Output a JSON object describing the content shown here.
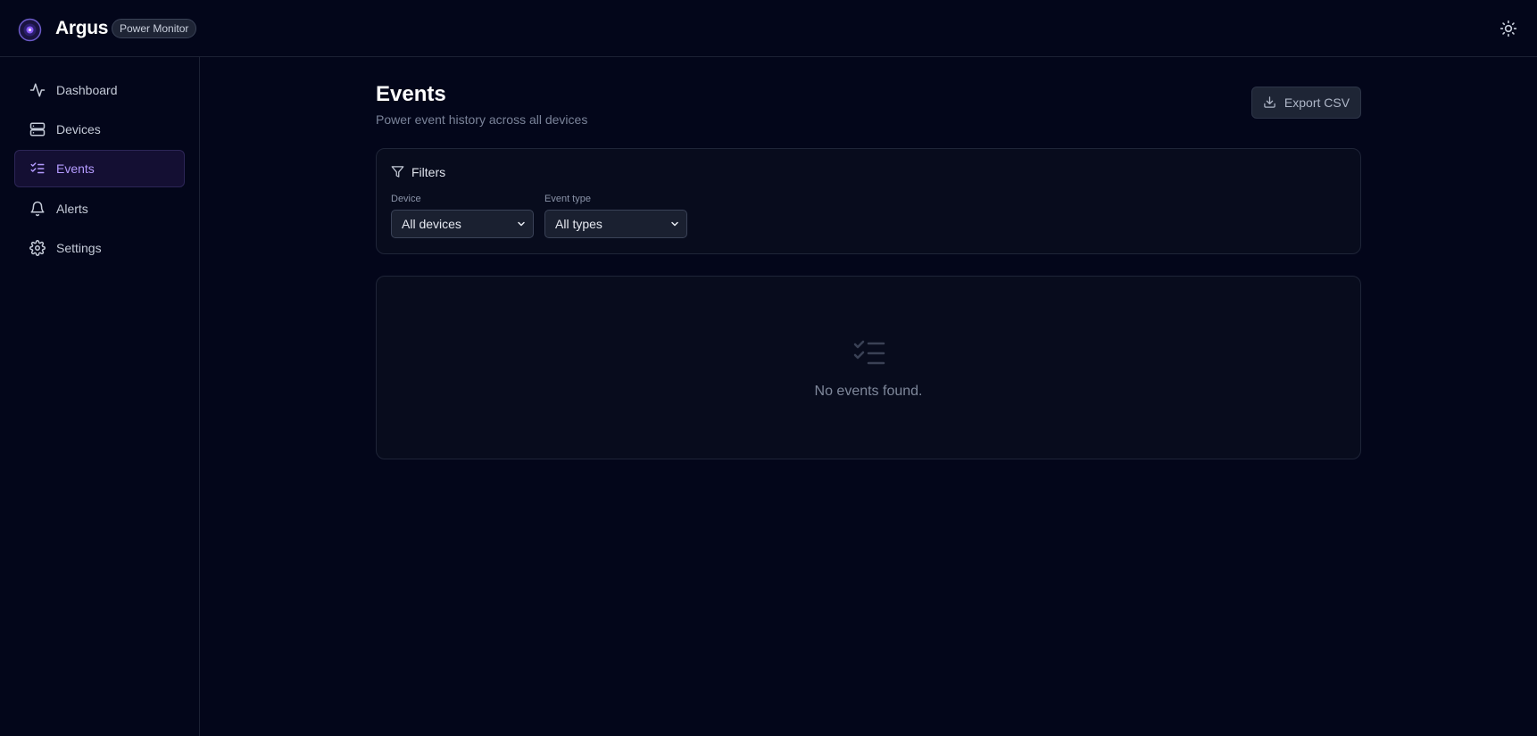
{
  "app": {
    "name": "Argus",
    "badge": "Power Monitor"
  },
  "sidebar": {
    "items": [
      {
        "label": "Dashboard",
        "icon": "activity-icon",
        "active": false
      },
      {
        "label": "Devices",
        "icon": "server-icon",
        "active": false
      },
      {
        "label": "Events",
        "icon": "list-checks-icon",
        "active": true
      },
      {
        "label": "Alerts",
        "icon": "bell-icon",
        "active": false
      },
      {
        "label": "Settings",
        "icon": "gear-icon",
        "active": false
      }
    ]
  },
  "page": {
    "title": "Events",
    "subtitle": "Power event history across all devices",
    "export_label": "Export CSV"
  },
  "filters": {
    "title": "Filters",
    "device": {
      "label": "Device",
      "value": "All devices"
    },
    "event_type": {
      "label": "Event type",
      "value": "All types"
    }
  },
  "empty": {
    "message": "No events found."
  },
  "colors": {
    "background": "#03061a",
    "accent": "#b49bff",
    "active_bg": "#140f33"
  }
}
